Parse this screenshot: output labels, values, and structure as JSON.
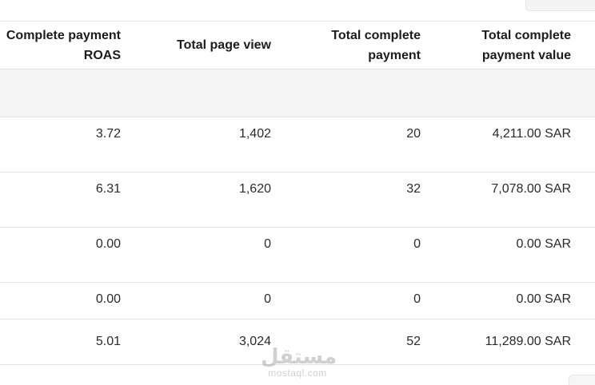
{
  "table": {
    "headers": [
      "Complete payment ROAS",
      "Total page view",
      "Total complete payment",
      "Total complete payment value"
    ],
    "rows": [
      [
        "3.72",
        "1,402",
        "20",
        "4,211.00 SAR"
      ],
      [
        "6.31",
        "1,620",
        "32",
        "7,078.00 SAR"
      ],
      [
        "0.00",
        "0",
        "0",
        "0.00 SAR"
      ],
      [
        "0.00",
        "0",
        "0",
        "0.00 SAR"
      ],
      [
        "5.01",
        "3,024",
        "52",
        "11,289.00 SAR"
      ]
    ]
  },
  "watermark": {
    "arabic": "مستقل",
    "latin": "mostaql.com"
  },
  "colors": {
    "border": "#e3e3e3",
    "band": "#f5f5f5",
    "text": "#1a1a1a"
  }
}
